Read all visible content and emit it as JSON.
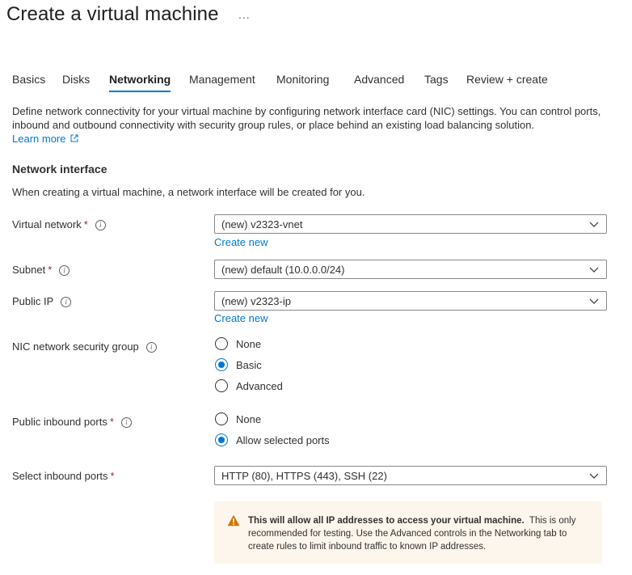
{
  "page": {
    "title": "Create a virtual machine",
    "more_label": "..."
  },
  "tabs": [
    {
      "label": "Basics"
    },
    {
      "label": "Disks"
    },
    {
      "label": "Networking",
      "active": true
    },
    {
      "label": "Management"
    },
    {
      "label": "Monitoring"
    },
    {
      "label": "Advanced"
    },
    {
      "label": "Tags"
    },
    {
      "label": "Review + create"
    }
  ],
  "intro": {
    "text": "Define network connectivity for your virtual machine by configuring network interface card (NIC) settings. You can control ports, inbound and outbound connectivity with security group rules, or place behind an existing load balancing solution.",
    "learn_more": "Learn more"
  },
  "network_interface": {
    "heading": "Network interface",
    "description": "When creating a virtual machine, a network interface will be created for you."
  },
  "fields": {
    "virtual_network": {
      "label": "Virtual network",
      "required": "*",
      "value": "(new) v2323-vnet",
      "create_new": "Create new"
    },
    "subnet": {
      "label": "Subnet",
      "required": "*",
      "value": "(new) default (10.0.0.0/24)"
    },
    "public_ip": {
      "label": "Public IP",
      "value": "(new) v2323-ip",
      "create_new": "Create new"
    },
    "nic_nsg": {
      "label": "NIC network security group",
      "options": [
        {
          "label": "None",
          "checked": false
        },
        {
          "label": "Basic",
          "checked": true
        },
        {
          "label": "Advanced",
          "checked": false
        }
      ]
    },
    "public_inbound_ports": {
      "label": "Public inbound ports",
      "required": "*",
      "options": [
        {
          "label": "None",
          "checked": false
        },
        {
          "label": "Allow selected ports",
          "checked": true
        }
      ]
    },
    "select_inbound_ports": {
      "label": "Select inbound ports",
      "required": "*",
      "value": "HTTP (80), HTTPS (443), SSH (22)"
    }
  },
  "warning": {
    "bold": "This will allow all IP addresses to access your virtual machine.",
    "text": "This is only recommended for testing.  Use the Advanced controls in the Networking tab to create rules to limit inbound traffic to known IP addresses."
  },
  "colors": {
    "accent": "#0078d4",
    "required": "#a4262c",
    "warning_bg": "#fdf6ec",
    "warning_icon": "#d47500"
  }
}
